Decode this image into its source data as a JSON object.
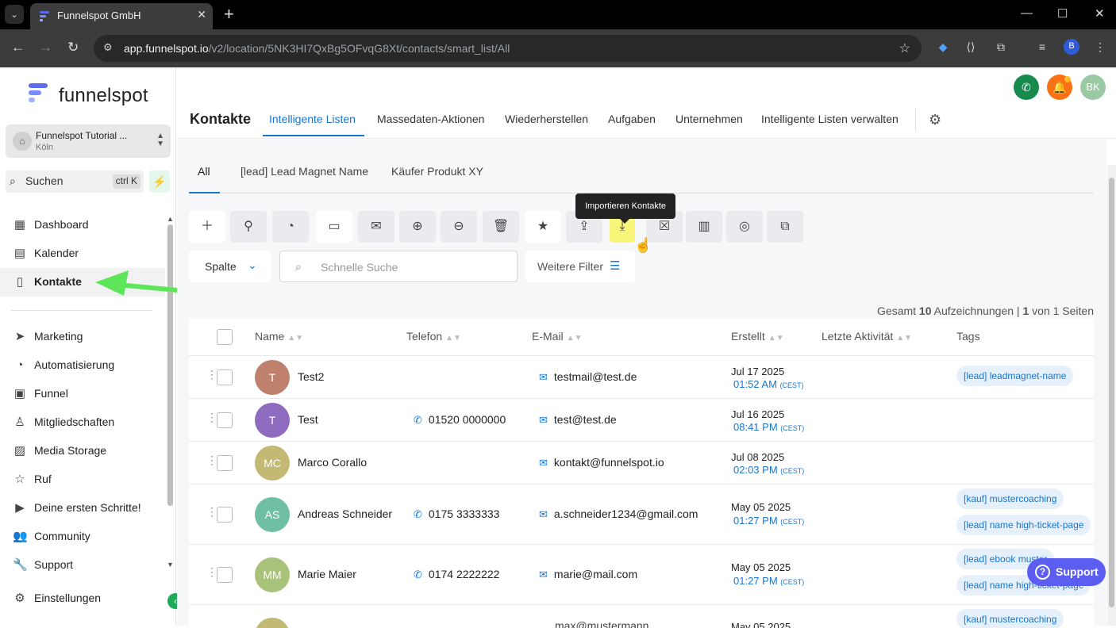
{
  "browser": {
    "tab_title": "Funnelspot GmbH",
    "url_host": "app.funnelspot.io",
    "url_path": "/v2/location/5NK3HI7QxBg5OFvqG8Xt/contacts/smart_list/All",
    "profile_initial": "B"
  },
  "sidebar": {
    "logo_text": "funnelspot",
    "account_name": "Funnelspot Tutorial ...",
    "account_sub": "Köln",
    "search_label": "Suchen",
    "search_shortcut": "ctrl K",
    "items": [
      {
        "label": "Dashboard",
        "icon": "grid-icon"
      },
      {
        "label": "Kalender",
        "icon": "calendar-icon"
      },
      {
        "label": "Kontakte",
        "icon": "contacts-icon"
      },
      {
        "label": "Marketing",
        "icon": "send-icon"
      },
      {
        "label": "Automatisierung",
        "icon": "automation-icon"
      },
      {
        "label": "Funnel",
        "icon": "funnel-icon"
      },
      {
        "label": "Mitgliedschaften",
        "icon": "membership-icon"
      },
      {
        "label": "Media Storage",
        "icon": "image-icon"
      },
      {
        "label": "Ruf",
        "icon": "star-icon"
      },
      {
        "label": "Deine ersten Schritte!",
        "icon": "play-icon"
      },
      {
        "label": "Community",
        "icon": "people-icon"
      },
      {
        "label": "Support",
        "icon": "wrench-icon"
      },
      {
        "label": "Einstellungen",
        "icon": "gear-icon"
      }
    ]
  },
  "header": {
    "title": "Kontakte",
    "tabs": [
      "Intelligente Listen",
      "Massedaten-Aktionen",
      "Wiederherstellen",
      "Aufgaben",
      "Unternehmen",
      "Intelligente Listen verwalten"
    ],
    "avatar_initials": "BK",
    "colors": {
      "phone": "#178a4e",
      "bell": "#f97316",
      "avatar": "#9bc9a3"
    }
  },
  "lists": {
    "tabs": [
      "All",
      "[lead] Lead Magnet Name",
      "Käufer Produkt XY"
    ]
  },
  "toolbar": {
    "tooltip": "Importieren Kontakte",
    "column_button": "Spalte",
    "search_placeholder": "Schnelle Suche",
    "filter_button": "Weitere Filter"
  },
  "summary": {
    "prefix": "Gesamt",
    "count": "10",
    "middle": "Aufzeichnungen |",
    "page": "1",
    "suffix": "von 1 Seiten"
  },
  "table": {
    "columns": [
      "Name",
      "Telefon",
      "E-Mail",
      "Erstellt",
      "Letzte Aktivität",
      "Tags"
    ],
    "rows": [
      {
        "initials": "T",
        "name": "Test2",
        "phone": "",
        "email": "testmail@test.de",
        "date": "Jul 17 2025",
        "time": "01:52 AM",
        "tz": "(CEST)",
        "tags": [
          "[lead] leadmagnet-name"
        ],
        "color": "#c0806e"
      },
      {
        "initials": "T",
        "name": "Test",
        "phone": "01520 0000000",
        "email": "test@test.de",
        "date": "Jul 16 2025",
        "time": "08:41 PM",
        "tz": "(CEST)",
        "tags": [],
        "color": "#8e6bbf"
      },
      {
        "initials": "MC",
        "name": "Marco Corallo",
        "phone": "",
        "email": "kontakt@funnelspot.io",
        "date": "Jul 08 2025",
        "time": "02:03 PM",
        "tz": "(CEST)",
        "tags": [],
        "color": "#c3b975"
      },
      {
        "initials": "AS",
        "name": "Andreas Schneider",
        "phone": "0175 3333333",
        "email": "a.schneider1234@gmail.com",
        "date": "May 05 2025",
        "time": "01:27 PM",
        "tz": "(CEST)",
        "tags": [
          "[kauf] mustercoaching",
          "[lead] name high-ticket-page"
        ],
        "color": "#6fbfa3"
      },
      {
        "initials": "MM",
        "name": "Marie Maier",
        "phone": "0174 2222222",
        "email": "marie@mail.com",
        "date": "May 05 2025",
        "time": "01:27 PM",
        "tz": "(CEST)",
        "tags": [
          "[lead] ebook muster",
          "[lead] name high-ticket-page"
        ],
        "color": "#a8c27a"
      },
      {
        "initials": "",
        "name": "",
        "phone": "",
        "email": "max@mustermann...",
        "date": "May 05 2025",
        "time": "",
        "tz": "",
        "tags": [
          "[kauf] mustercoaching"
        ],
        "color": "#c3b975"
      }
    ]
  },
  "support_button": "Support"
}
